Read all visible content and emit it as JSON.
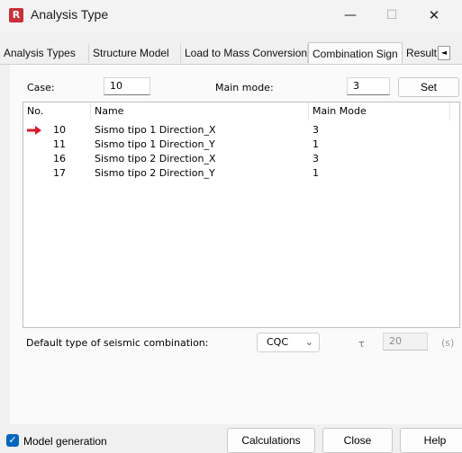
{
  "window": {
    "title": "Analysis Type",
    "icon_letter": "R",
    "minimize": "—",
    "maximize": "☐",
    "close": "✕"
  },
  "tabs": [
    {
      "label": "Analysis Types"
    },
    {
      "label": "Structure Model"
    },
    {
      "label": "Load to Mass Conversion"
    },
    {
      "label": "Combination Sign",
      "active": true
    },
    {
      "label": "Result"
    }
  ],
  "tab_scroll_left": "◄",
  "case_row": {
    "case_label": "Case:",
    "case_value": "10",
    "main_mode_label": "Main mode:",
    "main_mode_value": "3",
    "set_button": "Set"
  },
  "table": {
    "columns": [
      "No.",
      "Name",
      "Main Mode"
    ],
    "rows": [
      {
        "no": "10",
        "name": "Sismo tipo 1 Direction_X",
        "mode": "3",
        "selected": true
      },
      {
        "no": "11",
        "name": "Sismo tipo 1 Direction_Y",
        "mode": "1"
      },
      {
        "no": "16",
        "name": "Sismo tipo 2  Direction_X",
        "mode": "3"
      },
      {
        "no": "17",
        "name": "Sismo tipo 2  Direction_Y",
        "mode": "1"
      }
    ]
  },
  "seismic": {
    "label": "Default type of seismic combination:",
    "combo_value": "CQC",
    "tau_symbol": "τ",
    "tau_value": "20",
    "tau_unit": "(s)"
  },
  "footer": {
    "model_generation_label": "Model generation",
    "model_generation_checked": true,
    "calculations_button": "Calculations",
    "close_button": "Close",
    "help_button": "Help"
  },
  "colors": {
    "arrow": "#d7192a",
    "checkbox": "#0067c0"
  }
}
